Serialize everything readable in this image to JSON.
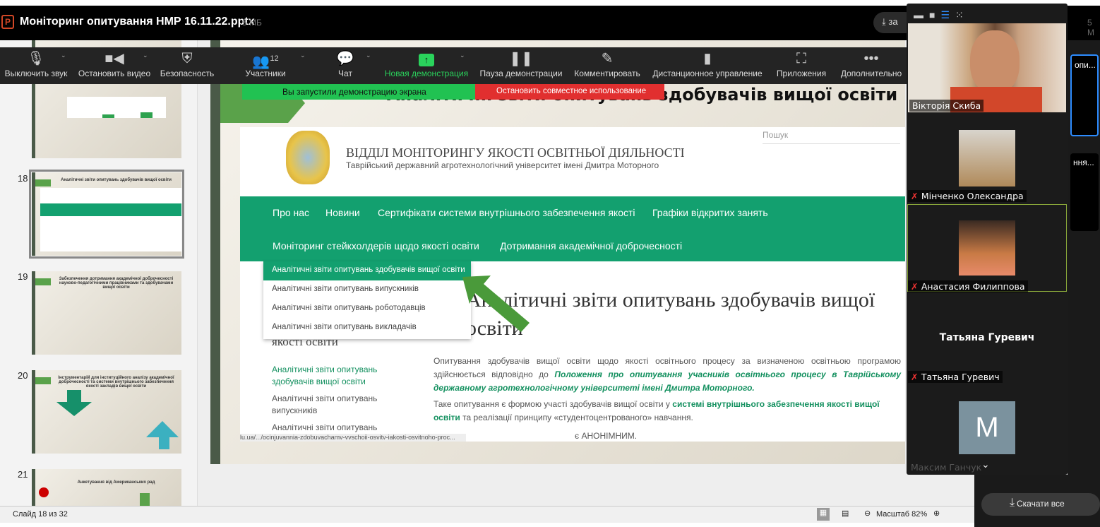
{
  "titlebar": {
    "title": "Моніторинг опитування НМР 16.11.22.pptx",
    "size": "5 МБ",
    "download_label": "за",
    "right_size": "5 М",
    "ppt_icon": "P"
  },
  "toolbar": {
    "items": [
      {
        "label": "Выключить звук",
        "icon": "microphone-icon"
      },
      {
        "label": "Остановить видео",
        "icon": "camera-icon"
      },
      {
        "label": "Безопасность",
        "icon": "shield-icon"
      },
      {
        "label": "Участники",
        "icon": "participants-icon",
        "count": "12"
      },
      {
        "label": "Чат",
        "icon": "chat-icon"
      },
      {
        "label": "Новая демонстрация",
        "icon": "share-icon"
      },
      {
        "label": "Пауза демонстрации",
        "icon": "pause-icon"
      },
      {
        "label": "Комментировать",
        "icon": "pencil-icon"
      },
      {
        "label": "Дистанционное управление",
        "icon": "mouse-icon"
      },
      {
        "label": "Приложения",
        "icon": "apps-icon"
      },
      {
        "label": "Дополнительно",
        "icon": "more-icon"
      }
    ]
  },
  "share": {
    "started": "Вы запустили демонстрацию экрана",
    "stop": "Остановить совместное использование"
  },
  "thumbnails": [
    {
      "num": "18",
      "title": "Аналітичні звіти опитувань здобувачів вищої освіти"
    },
    {
      "num": "19",
      "title": "Забезпечення дотримання академічної доброчесності науково-педагогічними працівниками та здобувачами вищої освіти"
    },
    {
      "num": "20",
      "title": "Інструментарій для інституційного аналізу академічної доброчесності та системи внутрішнього забезпечення якості закладів вищої освіти"
    },
    {
      "num": "21",
      "title": "Анкетування від Американських рад"
    }
  ],
  "slide": {
    "title": "Аналітичні звіти опитувань здобувачів вищої освіти",
    "web": {
      "dept": "ВІДДІЛ МОНІТОРИНГУ ЯКОСТІ ОСВІТНЬОЇ ДІЯЛЬНОСТІ",
      "univ": "Таврійський державний агротехнологічний університет імені Дмитра Моторного",
      "search_placeholder": "Пошук",
      "nav": [
        "Про нас",
        "Новини",
        "Сертифікати системи внутрішнього забезпечення якості",
        "Графіки відкритих занять",
        "Моніторинг стейкхолдерів щодо якості освіти",
        "Дотримання академічної доброчесності"
      ],
      "dropdown": [
        "Аналітичні звіти опитувань здобувачів вищої освіти",
        "Аналітичні звіти опитувань випускників",
        "Аналітичні звіти опитувань роботодавців",
        "Аналітичні звіти опитувань викладачів"
      ],
      "page_heading": "Аналітичні звіти опитувань здобувачів вищої освіти",
      "side_heading": "якості освіти",
      "side_links": [
        "Аналітичні звіти опитувань здобувачів вищої освіти",
        "Аналітичні звіти опитувань випускників",
        "Аналітичні звіти опитувань"
      ],
      "para1_a": "Опитування здобувачів вищої освіти щодо якості освітнього процесу за визначеною освітньою програмою здійснюється відповідно до ",
      "para1_link": "Положення про опитування учасників освітнього процесу в Таврійському державному агротехнологічному університеті імені Дмитра Моторного.",
      "para2_a": "Таке опитування є формою участі здобувачів  вищої освіти у ",
      "para2_link": "системі внутрішнього забезпечення якості вищої освіти",
      "para2_b": " та реалізації принципу «студентоцентрованого» навчання.",
      "para3": "є АНОНІМНИМ.",
      "url": "lu.ua/.../ocinjuvannia-zdobuvachamv-vvschoii-osvitv-iakosti-osvitnoho-proc..."
    }
  },
  "participants": [
    {
      "name": "Вікторія Скиба",
      "muted": false
    },
    {
      "name": "Мінченко Олександра",
      "muted": true
    },
    {
      "name": "Анастасия Филиппова",
      "muted": true
    },
    {
      "name": "Татьяна Гуревич",
      "muted": true,
      "center": "Татьяна Гуревич"
    },
    {
      "name": "Максим Ганчук",
      "avatar": "M"
    }
  ],
  "far_right": {
    "tile1": "опи...",
    "tile2": "ння..."
  },
  "status": {
    "slide": "Слайд 18 из 32",
    "zoom": "Масштаб 82%",
    "download_all": "Скачати все"
  }
}
